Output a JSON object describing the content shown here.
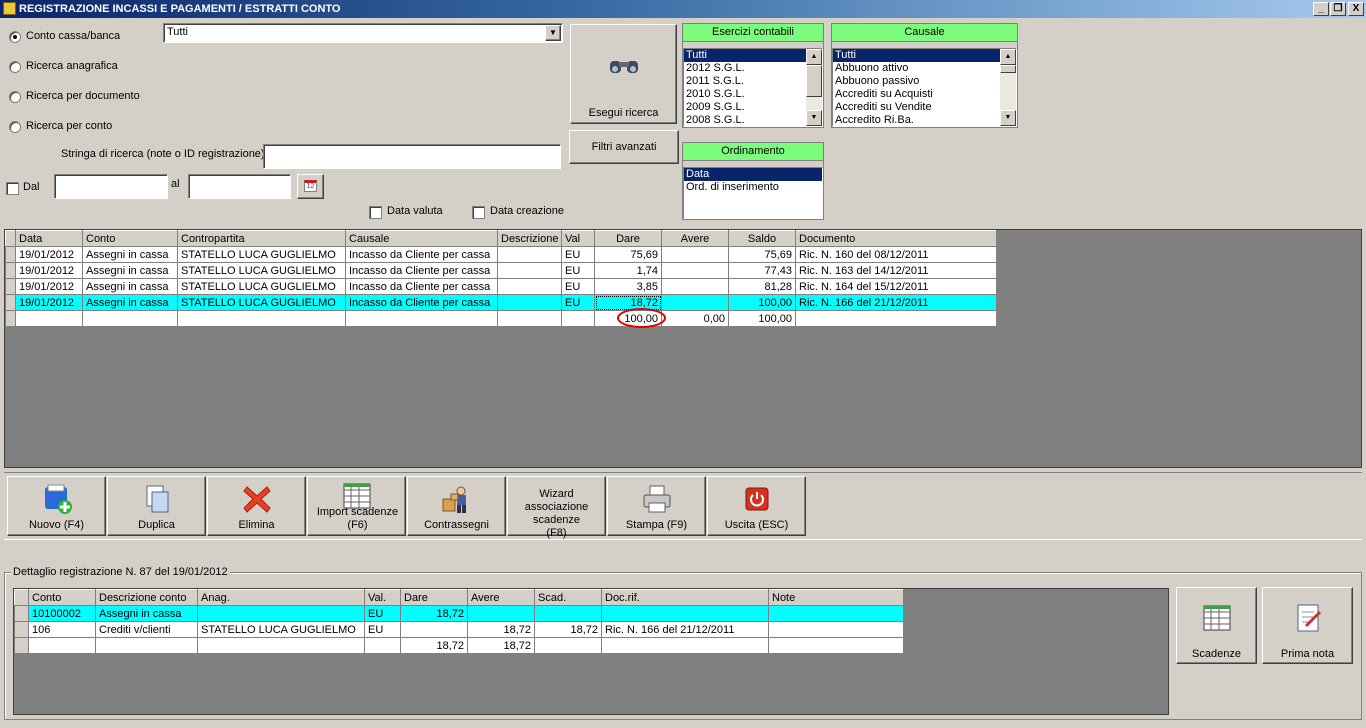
{
  "window": {
    "title": "REGISTRAZIONE INCASSI E PAGAMENTI / ESTRATTI CONTO",
    "min": "_",
    "restore": "❐",
    "close": "X"
  },
  "search_modes": [
    {
      "label": "Conto cassa/banca",
      "selected": true
    },
    {
      "label": "Ricerca anagrafica",
      "selected": false
    },
    {
      "label": "Ricerca per documento",
      "selected": false
    },
    {
      "label": "Ricerca per conto",
      "selected": false
    }
  ],
  "account_select": {
    "value": "Tutti"
  },
  "search_text": {
    "label": "Stringa di ricerca (note o ID registrazione)",
    "value": ""
  },
  "date_filter": {
    "from_label": "Dal",
    "to_label": "al",
    "from": "",
    "to": "",
    "calendar_day": "12"
  },
  "checks": {
    "data_valuta": "Data valuta",
    "data_creazione": "Data creazione"
  },
  "buttons": {
    "search": "Esegui ricerca",
    "advanced": "Filtri avanzati"
  },
  "esercizi": {
    "title": "Esercizi contabili",
    "items": [
      "Tutti",
      "2012 S.G.L.",
      "2011 S.G.L.",
      "2010 S.G.L.",
      "2009 S.G.L.",
      "2008 S.G.L."
    ]
  },
  "causale": {
    "title": "Causale",
    "items": [
      "Tutti",
      "Abbuono attivo",
      "Abbuono passivo",
      "Accrediti su Acquisti",
      "Accrediti su Vendite",
      "Accredito Ri.Ba."
    ]
  },
  "ordinamento": {
    "title": "Ordinamento",
    "items": [
      "Data",
      "Ord. di inserimento"
    ]
  },
  "main_grid": {
    "columns": [
      "Data",
      "Conto",
      "Contropartita",
      "Causale",
      "Descrizione",
      "Val",
      "Dare",
      "Avere",
      "Saldo",
      "Documento"
    ],
    "rows": [
      [
        "19/01/2012",
        "Assegni in cassa",
        "STATELLO LUCA GUGLIELMO",
        "Incasso da Cliente per cassa",
        "",
        "EU",
        "75,69",
        "",
        "75,69",
        "Ric. N. 160 del 08/12/2011"
      ],
      [
        "19/01/2012",
        "Assegni in cassa",
        "STATELLO LUCA GUGLIELMO",
        "Incasso da Cliente per cassa",
        "",
        "EU",
        "1,74",
        "",
        "77,43",
        "Ric. N. 163 del 14/12/2011"
      ],
      [
        "19/01/2012",
        "Assegni in cassa",
        "STATELLO LUCA GUGLIELMO",
        "Incasso da Cliente per cassa",
        "",
        "EU",
        "3,85",
        "",
        "81,28",
        "Ric. N. 164 del 15/12/2011"
      ],
      [
        "19/01/2012",
        "Assegni in cassa",
        "STATELLO LUCA GUGLIELMO",
        "Incasso da Cliente per cassa",
        "",
        "EU",
        "18,72",
        "",
        "100,00",
        "Ric. N. 166 del 21/12/2011"
      ]
    ],
    "totals": {
      "dare": "100,00",
      "avere": "0,00",
      "saldo": "100,00"
    }
  },
  "toolbar": [
    {
      "label": "Nuovo (F4)",
      "icon": "new-document-icon"
    },
    {
      "label": "Duplica",
      "icon": "duplicate-icon"
    },
    {
      "label": "Elimina",
      "icon": "delete-x-icon"
    },
    {
      "label": "Import scadenze (F6)",
      "icon": "spreadsheet-icon"
    },
    {
      "label": "Contrassegni",
      "icon": "delivery-man-icon"
    },
    {
      "label": "Wizard associazione scadenze (F8)",
      "icon": ""
    },
    {
      "label": "Stampa (F9)",
      "icon": "printer-icon"
    },
    {
      "label": "Uscita (ESC)",
      "icon": "power-icon"
    }
  ],
  "detail": {
    "title": "Dettaglio registrazione N. 87 del 19/01/2012",
    "columns": [
      "Conto",
      "Descrizione conto",
      "Anag.",
      "Val.",
      "Dare",
      "Avere",
      "Scad.",
      "Doc.rif.",
      "Note"
    ],
    "rows": [
      [
        "10100002",
        "Assegni in cassa",
        "",
        "EU",
        "18,72",
        "",
        "",
        "",
        ""
      ],
      [
        "106",
        "Crediti v/clienti",
        "STATELLO LUCA GUGLIELMO",
        "EU",
        "",
        "18,72",
        "18,72",
        "Ric. N. 166 del 21/12/2011",
        ""
      ]
    ],
    "totals": {
      "dare": "18,72",
      "avere": "18,72"
    },
    "buttons": {
      "scadenze": "Scadenze",
      "prima_nota": "Prima nota"
    }
  },
  "colors": {
    "highlight": "#00ffff",
    "header_green": "#7cfc7c",
    "selection": "#0a246a",
    "title_bar": "#0a246a",
    "circle": "#e00000"
  }
}
